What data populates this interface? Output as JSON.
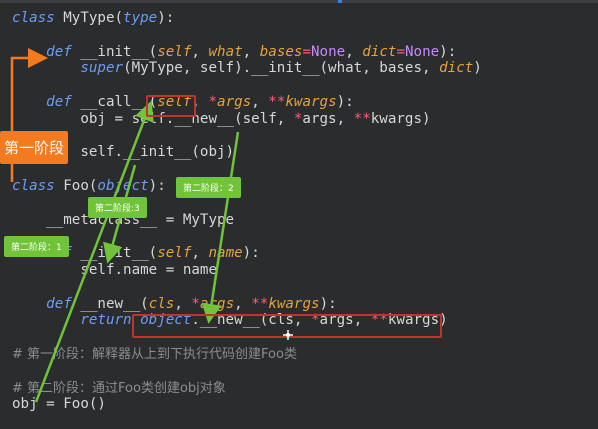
{
  "code": {
    "lines": [
      {
        "parts": [
          [
            "kw",
            "class "
          ],
          [
            "fn",
            "MyType("
          ],
          [
            "kw",
            "type"
          ],
          [
            "fn",
            "):"
          ]
        ]
      },
      {
        "parts": []
      },
      {
        "parts": [
          [
            "fn",
            "    "
          ],
          [
            "kw",
            "def "
          ],
          [
            "fn",
            "__init__("
          ],
          [
            "par",
            "self"
          ],
          [
            "fn",
            ", "
          ],
          [
            "par",
            "what"
          ],
          [
            "fn",
            ", "
          ],
          [
            "par",
            "bases"
          ],
          [
            "op",
            "="
          ],
          [
            "none",
            "None"
          ],
          [
            "fn",
            ", "
          ],
          [
            "par",
            "dict"
          ],
          [
            "op",
            "="
          ],
          [
            "none",
            "None"
          ],
          [
            "fn",
            "):"
          ]
        ]
      },
      {
        "parts": [
          [
            "fn",
            "        "
          ],
          [
            "kw",
            "super"
          ],
          [
            "fn",
            "(MyType, self).__init__(what, bases, "
          ],
          [
            "par",
            "dict"
          ],
          [
            "fn",
            ")"
          ]
        ]
      },
      {
        "parts": []
      },
      {
        "parts": [
          [
            "fn",
            "    "
          ],
          [
            "kw",
            "def "
          ],
          [
            "fn",
            "__call__("
          ],
          [
            "par",
            "self"
          ],
          [
            "fn",
            ", "
          ],
          [
            "op",
            "*"
          ],
          [
            "par",
            "args"
          ],
          [
            "fn",
            ", "
          ],
          [
            "op",
            "**"
          ],
          [
            "par",
            "kwargs"
          ],
          [
            "fn",
            "):"
          ]
        ]
      },
      {
        "parts": [
          [
            "fn",
            "        obj = self.__new__(self, "
          ],
          [
            "op",
            "*"
          ],
          [
            "fn",
            "args, "
          ],
          [
            "op",
            "**"
          ],
          [
            "fn",
            "kwargs)"
          ]
        ]
      },
      {
        "parts": []
      },
      {
        "parts": [
          [
            "fn",
            "        self.__init__(obj)"
          ]
        ]
      },
      {
        "parts": []
      },
      {
        "parts": [
          [
            "kw",
            "class "
          ],
          [
            "fn",
            "Foo("
          ],
          [
            "kw",
            "object"
          ],
          [
            "fn",
            "):"
          ]
        ]
      },
      {
        "parts": []
      },
      {
        "parts": [
          [
            "fn",
            "    __metaclass__ = MyType"
          ]
        ]
      },
      {
        "parts": []
      },
      {
        "parts": [
          [
            "fn",
            "    "
          ],
          [
            "kw",
            "def "
          ],
          [
            "fn",
            "__init__("
          ],
          [
            "par",
            "self"
          ],
          [
            "fn",
            ", "
          ],
          [
            "par",
            "name"
          ],
          [
            "fn",
            "):"
          ]
        ]
      },
      {
        "parts": [
          [
            "fn",
            "        self.name = name"
          ]
        ]
      },
      {
        "parts": []
      },
      {
        "parts": [
          [
            "fn",
            "    "
          ],
          [
            "kw",
            "def "
          ],
          [
            "fn",
            "__new__("
          ],
          [
            "par",
            "cls"
          ],
          [
            "fn",
            ", "
          ],
          [
            "op",
            "*"
          ],
          [
            "par",
            "args"
          ],
          [
            "fn",
            ", "
          ],
          [
            "op",
            "**"
          ],
          [
            "par",
            "kwargs"
          ],
          [
            "fn",
            "):"
          ]
        ]
      },
      {
        "parts": [
          [
            "fn",
            "        "
          ],
          [
            "kw",
            "return "
          ],
          [
            "obj",
            "object"
          ],
          [
            "fn",
            ".__new__(cls, "
          ],
          [
            "op",
            "*"
          ],
          [
            "fn",
            "args, "
          ],
          [
            "op",
            "**"
          ],
          [
            "fn",
            "kwargs)"
          ]
        ]
      },
      {
        "parts": []
      },
      {
        "parts": [
          [
            "cm",
            "# 第一阶段：解释器从上到下执行代码创建Foo类"
          ]
        ]
      },
      {
        "parts": []
      },
      {
        "parts": [
          [
            "cm",
            "# 第二阶段：通过Foo类创建obj对象"
          ]
        ]
      },
      {
        "parts": [
          [
            "fn",
            "obj = Foo()"
          ]
        ]
      }
    ]
  },
  "annotations": {
    "stage1_orange": "第一阶段",
    "stage2_1": "第二阶段：1",
    "stage2_2": "第二阶段：2",
    "stage2_3": "第二阶段:3"
  },
  "colors": {
    "background": "#2a2c2e",
    "keyword": "#6d9cf4",
    "param": "#e6a23c",
    "none": "#c689ff",
    "operator": "#ff5c7a",
    "comment": "#8a8d91",
    "annotation_green": "#71c43a",
    "annotation_orange": "#f47a20",
    "highlight_box": "#c0342d"
  }
}
